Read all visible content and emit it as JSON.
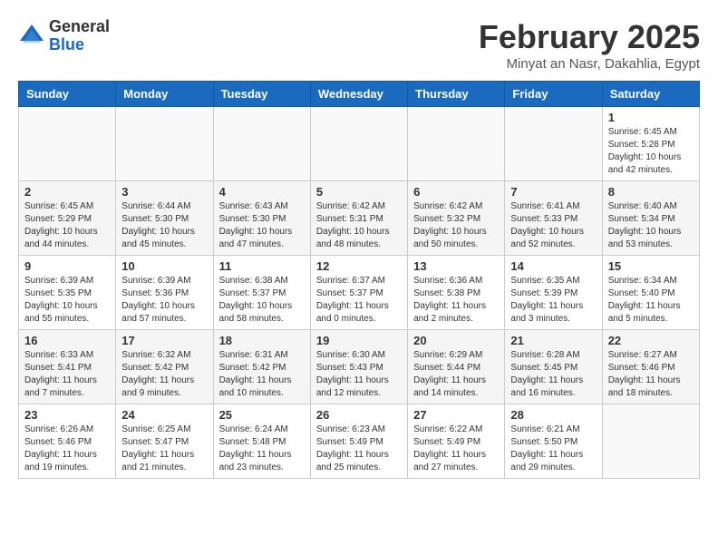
{
  "header": {
    "logo_general": "General",
    "logo_blue": "Blue",
    "title": "February 2025",
    "subtitle": "Minyat an Nasr, Dakahlia, Egypt"
  },
  "weekdays": [
    "Sunday",
    "Monday",
    "Tuesday",
    "Wednesday",
    "Thursday",
    "Friday",
    "Saturday"
  ],
  "weeks": [
    [
      {
        "day": "",
        "info": ""
      },
      {
        "day": "",
        "info": ""
      },
      {
        "day": "",
        "info": ""
      },
      {
        "day": "",
        "info": ""
      },
      {
        "day": "",
        "info": ""
      },
      {
        "day": "",
        "info": ""
      },
      {
        "day": "1",
        "info": "Sunrise: 6:45 AM\nSunset: 5:28 PM\nDaylight: 10 hours and 42 minutes."
      }
    ],
    [
      {
        "day": "2",
        "info": "Sunrise: 6:45 AM\nSunset: 5:29 PM\nDaylight: 10 hours and 44 minutes."
      },
      {
        "day": "3",
        "info": "Sunrise: 6:44 AM\nSunset: 5:30 PM\nDaylight: 10 hours and 45 minutes."
      },
      {
        "day": "4",
        "info": "Sunrise: 6:43 AM\nSunset: 5:30 PM\nDaylight: 10 hours and 47 minutes."
      },
      {
        "day": "5",
        "info": "Sunrise: 6:42 AM\nSunset: 5:31 PM\nDaylight: 10 hours and 48 minutes."
      },
      {
        "day": "6",
        "info": "Sunrise: 6:42 AM\nSunset: 5:32 PM\nDaylight: 10 hours and 50 minutes."
      },
      {
        "day": "7",
        "info": "Sunrise: 6:41 AM\nSunset: 5:33 PM\nDaylight: 10 hours and 52 minutes."
      },
      {
        "day": "8",
        "info": "Sunrise: 6:40 AM\nSunset: 5:34 PM\nDaylight: 10 hours and 53 minutes."
      }
    ],
    [
      {
        "day": "9",
        "info": "Sunrise: 6:39 AM\nSunset: 5:35 PM\nDaylight: 10 hours and 55 minutes."
      },
      {
        "day": "10",
        "info": "Sunrise: 6:39 AM\nSunset: 5:36 PM\nDaylight: 10 hours and 57 minutes."
      },
      {
        "day": "11",
        "info": "Sunrise: 6:38 AM\nSunset: 5:37 PM\nDaylight: 10 hours and 58 minutes."
      },
      {
        "day": "12",
        "info": "Sunrise: 6:37 AM\nSunset: 5:37 PM\nDaylight: 11 hours and 0 minutes."
      },
      {
        "day": "13",
        "info": "Sunrise: 6:36 AM\nSunset: 5:38 PM\nDaylight: 11 hours and 2 minutes."
      },
      {
        "day": "14",
        "info": "Sunrise: 6:35 AM\nSunset: 5:39 PM\nDaylight: 11 hours and 3 minutes."
      },
      {
        "day": "15",
        "info": "Sunrise: 6:34 AM\nSunset: 5:40 PM\nDaylight: 11 hours and 5 minutes."
      }
    ],
    [
      {
        "day": "16",
        "info": "Sunrise: 6:33 AM\nSunset: 5:41 PM\nDaylight: 11 hours and 7 minutes."
      },
      {
        "day": "17",
        "info": "Sunrise: 6:32 AM\nSunset: 5:42 PM\nDaylight: 11 hours and 9 minutes."
      },
      {
        "day": "18",
        "info": "Sunrise: 6:31 AM\nSunset: 5:42 PM\nDaylight: 11 hours and 10 minutes."
      },
      {
        "day": "19",
        "info": "Sunrise: 6:30 AM\nSunset: 5:43 PM\nDaylight: 11 hours and 12 minutes."
      },
      {
        "day": "20",
        "info": "Sunrise: 6:29 AM\nSunset: 5:44 PM\nDaylight: 11 hours and 14 minutes."
      },
      {
        "day": "21",
        "info": "Sunrise: 6:28 AM\nSunset: 5:45 PM\nDaylight: 11 hours and 16 minutes."
      },
      {
        "day": "22",
        "info": "Sunrise: 6:27 AM\nSunset: 5:46 PM\nDaylight: 11 hours and 18 minutes."
      }
    ],
    [
      {
        "day": "23",
        "info": "Sunrise: 6:26 AM\nSunset: 5:46 PM\nDaylight: 11 hours and 19 minutes."
      },
      {
        "day": "24",
        "info": "Sunrise: 6:25 AM\nSunset: 5:47 PM\nDaylight: 11 hours and 21 minutes."
      },
      {
        "day": "25",
        "info": "Sunrise: 6:24 AM\nSunset: 5:48 PM\nDaylight: 11 hours and 23 minutes."
      },
      {
        "day": "26",
        "info": "Sunrise: 6:23 AM\nSunset: 5:49 PM\nDaylight: 11 hours and 25 minutes."
      },
      {
        "day": "27",
        "info": "Sunrise: 6:22 AM\nSunset: 5:49 PM\nDaylight: 11 hours and 27 minutes."
      },
      {
        "day": "28",
        "info": "Sunrise: 6:21 AM\nSunset: 5:50 PM\nDaylight: 11 hours and 29 minutes."
      },
      {
        "day": "",
        "info": ""
      }
    ]
  ]
}
